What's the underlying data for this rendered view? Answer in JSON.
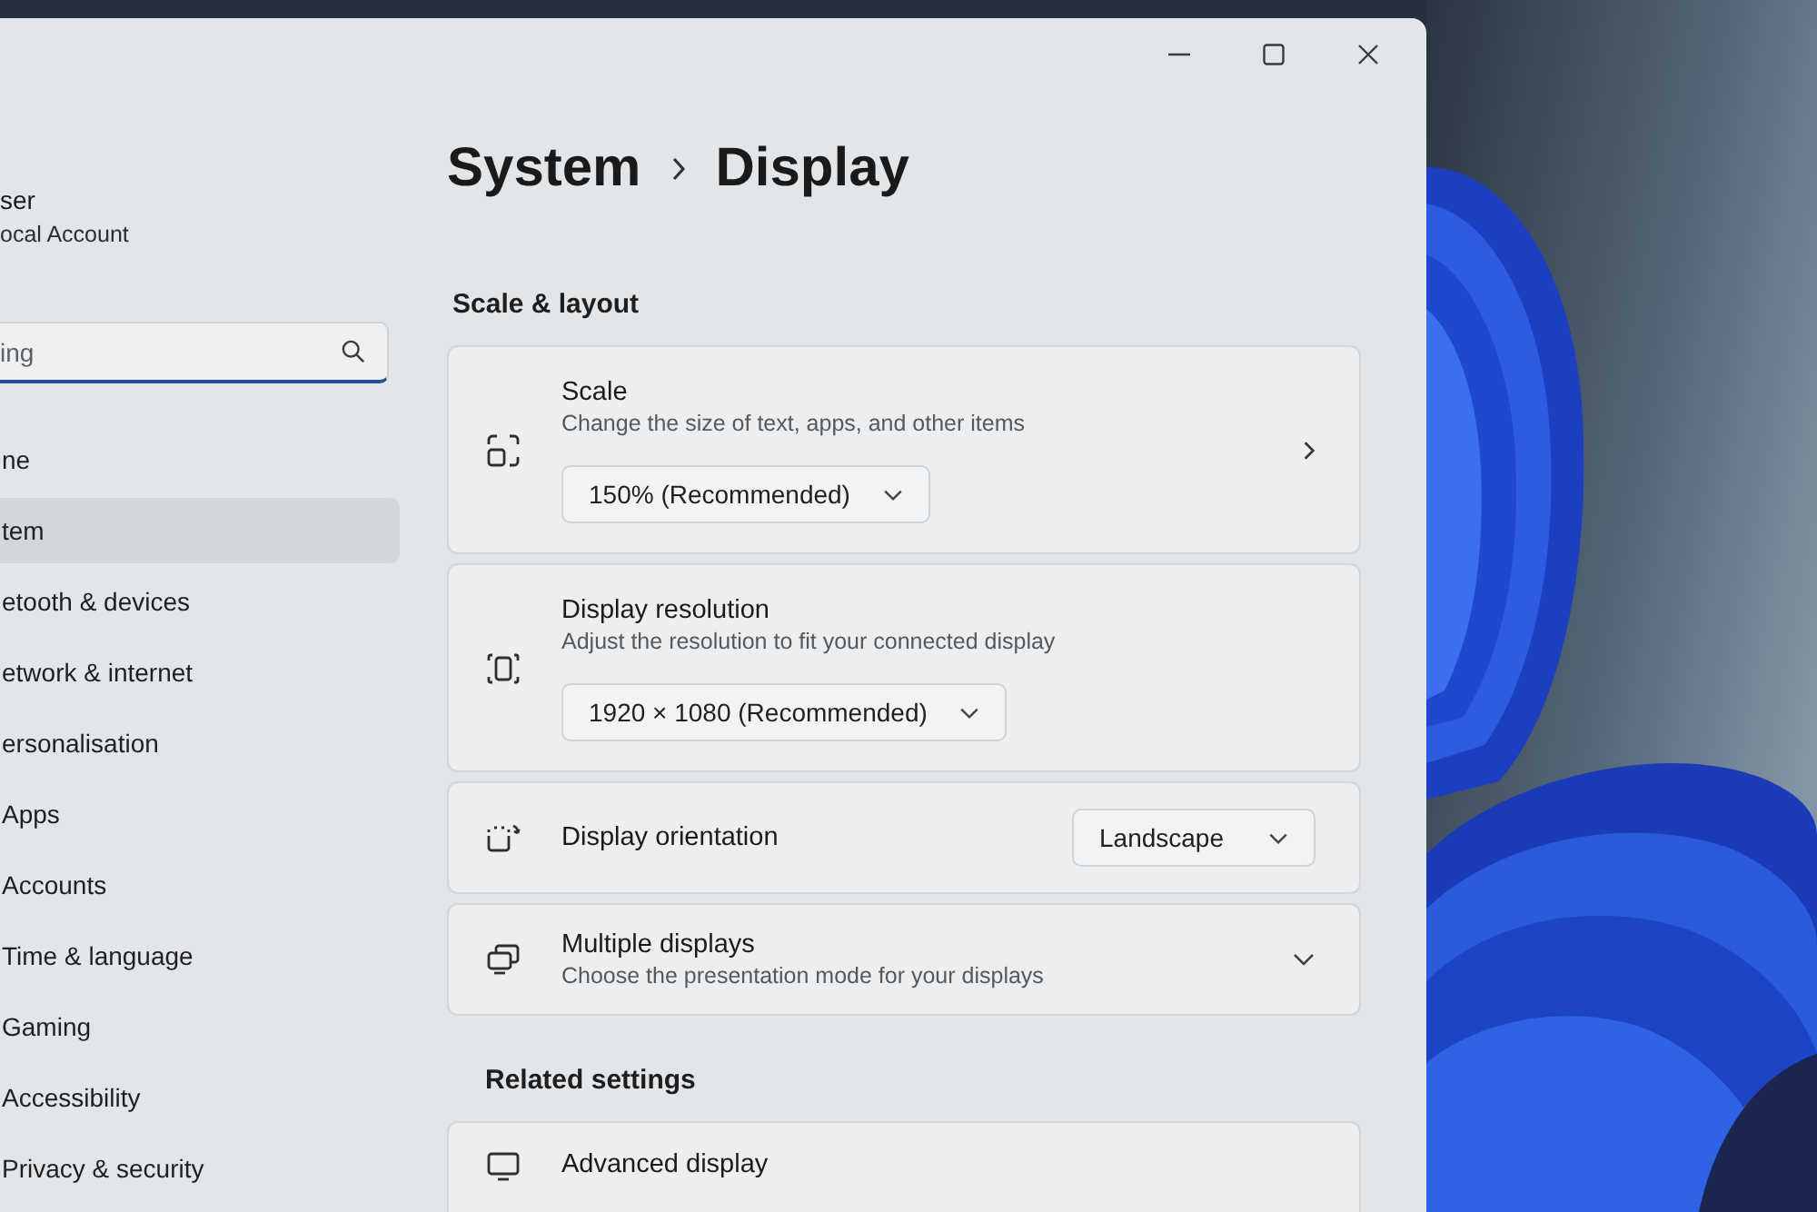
{
  "account": {
    "name": "ser",
    "type": "ocal Account"
  },
  "search": {
    "placeholder": "ing"
  },
  "nav": [
    {
      "label": "ne",
      "selected": false
    },
    {
      "label": "tem",
      "selected": true
    },
    {
      "label": "etooth & devices",
      "selected": false
    },
    {
      "label": "etwork & internet",
      "selected": false
    },
    {
      "label": "ersonalisation",
      "selected": false
    },
    {
      "label": "Apps",
      "selected": false
    },
    {
      "label": "Accounts",
      "selected": false
    },
    {
      "label": "Time & language",
      "selected": false
    },
    {
      "label": "Gaming",
      "selected": false
    },
    {
      "label": "Accessibility",
      "selected": false
    },
    {
      "label": "Privacy & security",
      "selected": false
    }
  ],
  "breadcrumb": {
    "parent": "System",
    "current": "Display"
  },
  "section": "Scale & layout",
  "cards": [
    {
      "kind": "dropdown-link",
      "title": "Scale",
      "description": "Change the size of text, apps, and other items",
      "value": "150% (Recommended)"
    },
    {
      "kind": "dropdown",
      "title": "Display resolution",
      "description": "Adjust the resolution to fit your connected display",
      "value": "1920 × 1080 (Recommended)"
    },
    {
      "kind": "select",
      "title": "Display orientation",
      "value": "Landscape"
    },
    {
      "kind": "expander",
      "title": "Multiple displays",
      "description": "Choose the presentation mode for your displays",
      "expanded": false
    }
  ],
  "related": {
    "heading": "Related settings",
    "cards": [
      {
        "kind": "plain",
        "title": "Advanced display"
      }
    ]
  }
}
